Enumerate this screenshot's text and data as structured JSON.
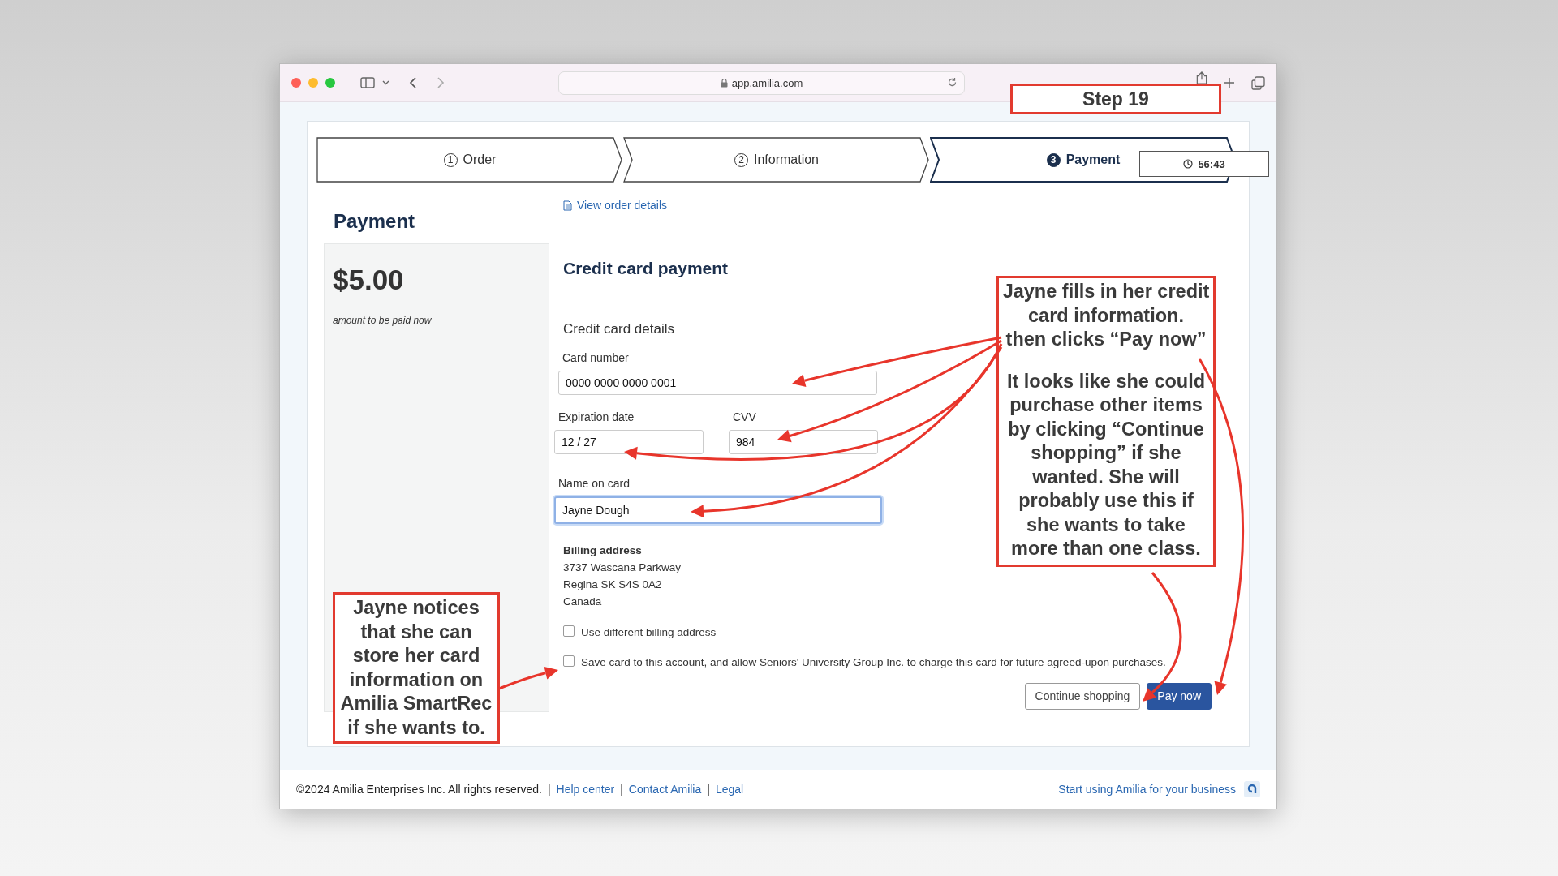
{
  "browser": {
    "url": "app.amilia.com"
  },
  "steps": [
    {
      "number": "1",
      "label": "Order",
      "selected": false
    },
    {
      "number": "2",
      "label": "Information",
      "selected": false
    },
    {
      "number": "3",
      "label": "Payment",
      "selected": true
    }
  ],
  "timer": "56:43",
  "payment_heading": "Payment",
  "amount": "$5.00",
  "amount_caption": "amount to be paid now",
  "view_order_link": "View order details",
  "form": {
    "title": "Credit card payment",
    "subtitle": "Credit card details",
    "field_rows": [
      [
        {
          "label": "Card number",
          "value": "0000 0000 0000 0001",
          "focused": false
        }
      ],
      [
        {
          "label": "Expiration date",
          "value": "12 / 27",
          "focused": false
        },
        {
          "label": "CVV",
          "value": "984",
          "focused": false
        }
      ],
      [
        {
          "label": "Name on card",
          "value": "Jayne Dough",
          "focused": true
        }
      ]
    ]
  },
  "billing": {
    "heading": "Billing address",
    "lines": [
      "3737 Wascana Parkway",
      "Regina SK S4S 0A2",
      "Canada"
    ]
  },
  "checkboxes": [
    {
      "label": "Use different billing address",
      "checked": false
    },
    {
      "label": "Save card to this account, and allow Seniors' University Group Inc. to charge this card for future agreed-upon purchases.",
      "checked": false
    }
  ],
  "buttons": [
    {
      "label": "Continue shopping",
      "kind": "secondary"
    },
    {
      "label": "Pay now",
      "kind": "primary"
    }
  ],
  "footer": {
    "copyright": "©2024 Amilia Enterprises Inc. All rights reserved.",
    "separator": "|",
    "links": [
      "Help center",
      "Contact Amilia",
      "Legal"
    ],
    "promo": "Start using Amilia for your business"
  },
  "annotations": {
    "step": "Step 19",
    "right_note": [
      "Jayne fills in her credit\ncard information.\nthen clicks “Pay now”",
      "It looks like she could\npurchase other items\nby clicking “Continue\nshopping” if she\nwanted. She will\nprobably use this if\nshe wants to take\nmore than one class."
    ],
    "left_note": "Jayne notices that she can store her card information on Amilia SmartRec if she wants to."
  }
}
